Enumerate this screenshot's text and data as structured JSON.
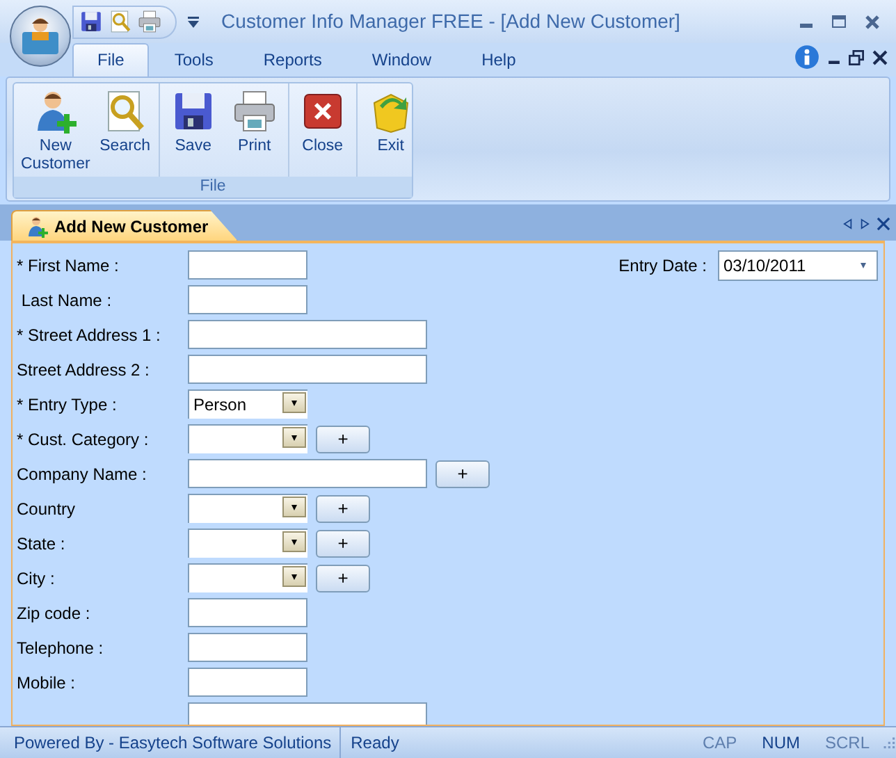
{
  "window": {
    "title": "Customer Info Manager FREE - [Add New Customer]"
  },
  "menu_tabs": [
    {
      "label": "File",
      "selected": true
    },
    {
      "label": "Tools",
      "selected": false
    },
    {
      "label": "Reports",
      "selected": false
    },
    {
      "label": "Window",
      "selected": false
    },
    {
      "label": "Help",
      "selected": false
    }
  ],
  "ribbon": {
    "groups": [
      {
        "label": "File",
        "sections": [
          [
            {
              "label": "New Customer",
              "kind": "new-customer"
            },
            {
              "label": "Search",
              "kind": "search"
            }
          ],
          [
            {
              "label": "Save",
              "kind": "save"
            },
            {
              "label": "Print",
              "kind": "print"
            }
          ],
          [
            {
              "label": "Close",
              "kind": "close"
            }
          ],
          [
            {
              "label": "Exit",
              "kind": "exit"
            }
          ]
        ]
      }
    ]
  },
  "document_tab": {
    "label": "Add New Customer",
    "selected": true
  },
  "form": {
    "fields": [
      {
        "label": "* First Name :",
        "kind": "short-text"
      },
      {
        "label": " Last Name :",
        "kind": "short-text"
      },
      {
        "label": "* Street Address 1 :",
        "kind": "long-text"
      },
      {
        "label": "Street Address 2 :",
        "kind": "long-text"
      },
      {
        "label": "* Entry Type :",
        "kind": "combo",
        "value": "Person"
      },
      {
        "label": "* Cust. Category :",
        "kind": "combo",
        "add_button": "+"
      },
      {
        "label": "Company Name :",
        "kind": "long-text",
        "add_button": "+"
      },
      {
        "label": "Country",
        "kind": "combo",
        "add_button": "+"
      },
      {
        "label": "State :",
        "kind": "combo",
        "add_button": "+"
      },
      {
        "label": "City :",
        "kind": "combo",
        "add_button": "+"
      },
      {
        "label": "Zip code :",
        "kind": "short-text"
      },
      {
        "label": "Telephone :",
        "kind": "short-text"
      },
      {
        "label": "Mobile :",
        "kind": "short-text"
      },
      {
        "kind": "long-text"
      }
    ],
    "entry_date": {
      "label": "Entry Date :",
      "value": "03/10/2011"
    }
  },
  "status_bar": {
    "credit": "Powered By - Easytech Software Solutions",
    "message": "Ready",
    "indicators": [
      {
        "label": "CAP",
        "on": false
      },
      {
        "label": "NUM",
        "on": true
      },
      {
        "label": "SCRL",
        "on": false
      }
    ]
  }
}
